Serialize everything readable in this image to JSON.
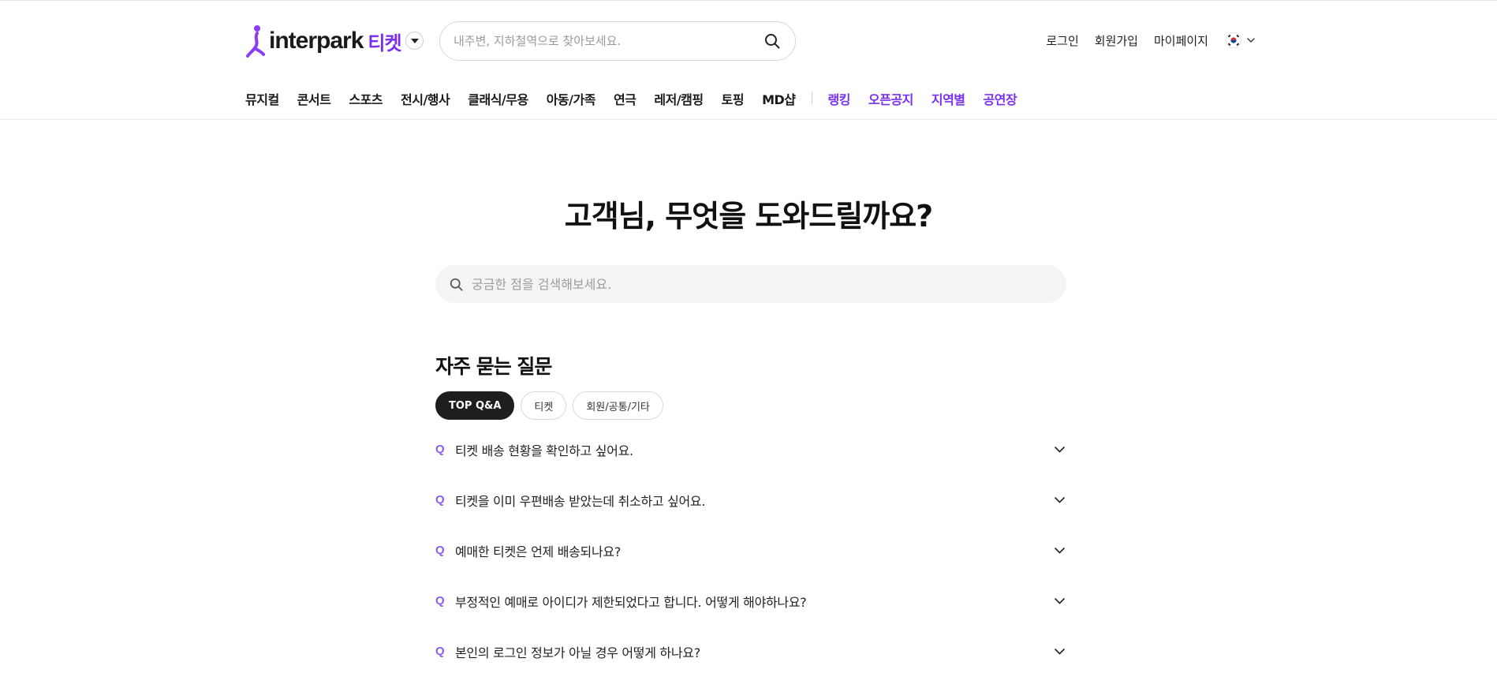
{
  "header": {
    "logo_text": "interpark",
    "logo_sub": "티켓",
    "search": {
      "placeholder": "내주변, 지하철역으로 찾아보세요.",
      "value": ""
    },
    "util_links": [
      "로그인",
      "회원가입",
      "마이페이지"
    ],
    "language_icon": "korea-flag-icon"
  },
  "nav": {
    "items": [
      "뮤지컬",
      "콘서트",
      "스포츠",
      "전시/행사",
      "클래식/무용",
      "아동/가족",
      "연극",
      "레저/캠핑",
      "토핑",
      "MD샵"
    ],
    "purple_items": [
      "랭킹",
      "오픈공지",
      "지역별",
      "공연장"
    ]
  },
  "main": {
    "title": "고객님, 무엇을 도와드릴까요?",
    "search": {
      "placeholder": "궁금한 점을 검색해보세요.",
      "value": ""
    }
  },
  "faq": {
    "title": "자주 묻는 질문",
    "chips": [
      "TOP Q&A",
      "티켓",
      "회원/공통/기타"
    ],
    "active_chip": 0,
    "q_marker": "Q",
    "items": [
      "티켓 배송 현황을 확인하고 싶어요.",
      "티켓을 이미 우편배송 받았는데 취소하고 싶어요.",
      "예매한 티켓은 언제 배송되나요?",
      "부정적인 예매로 아이디가 제한되었다고 합니다. 어떻게 해야하나요?",
      "본인의 로그인 정보가 아닐 경우 어떻게 하나요?"
    ]
  },
  "colors": {
    "brand_purple": "#7b2ff2",
    "q_purple": "#8b5cf6",
    "chip_active_bg": "#1e1e1e",
    "search_bg": "#f4f4f4"
  }
}
